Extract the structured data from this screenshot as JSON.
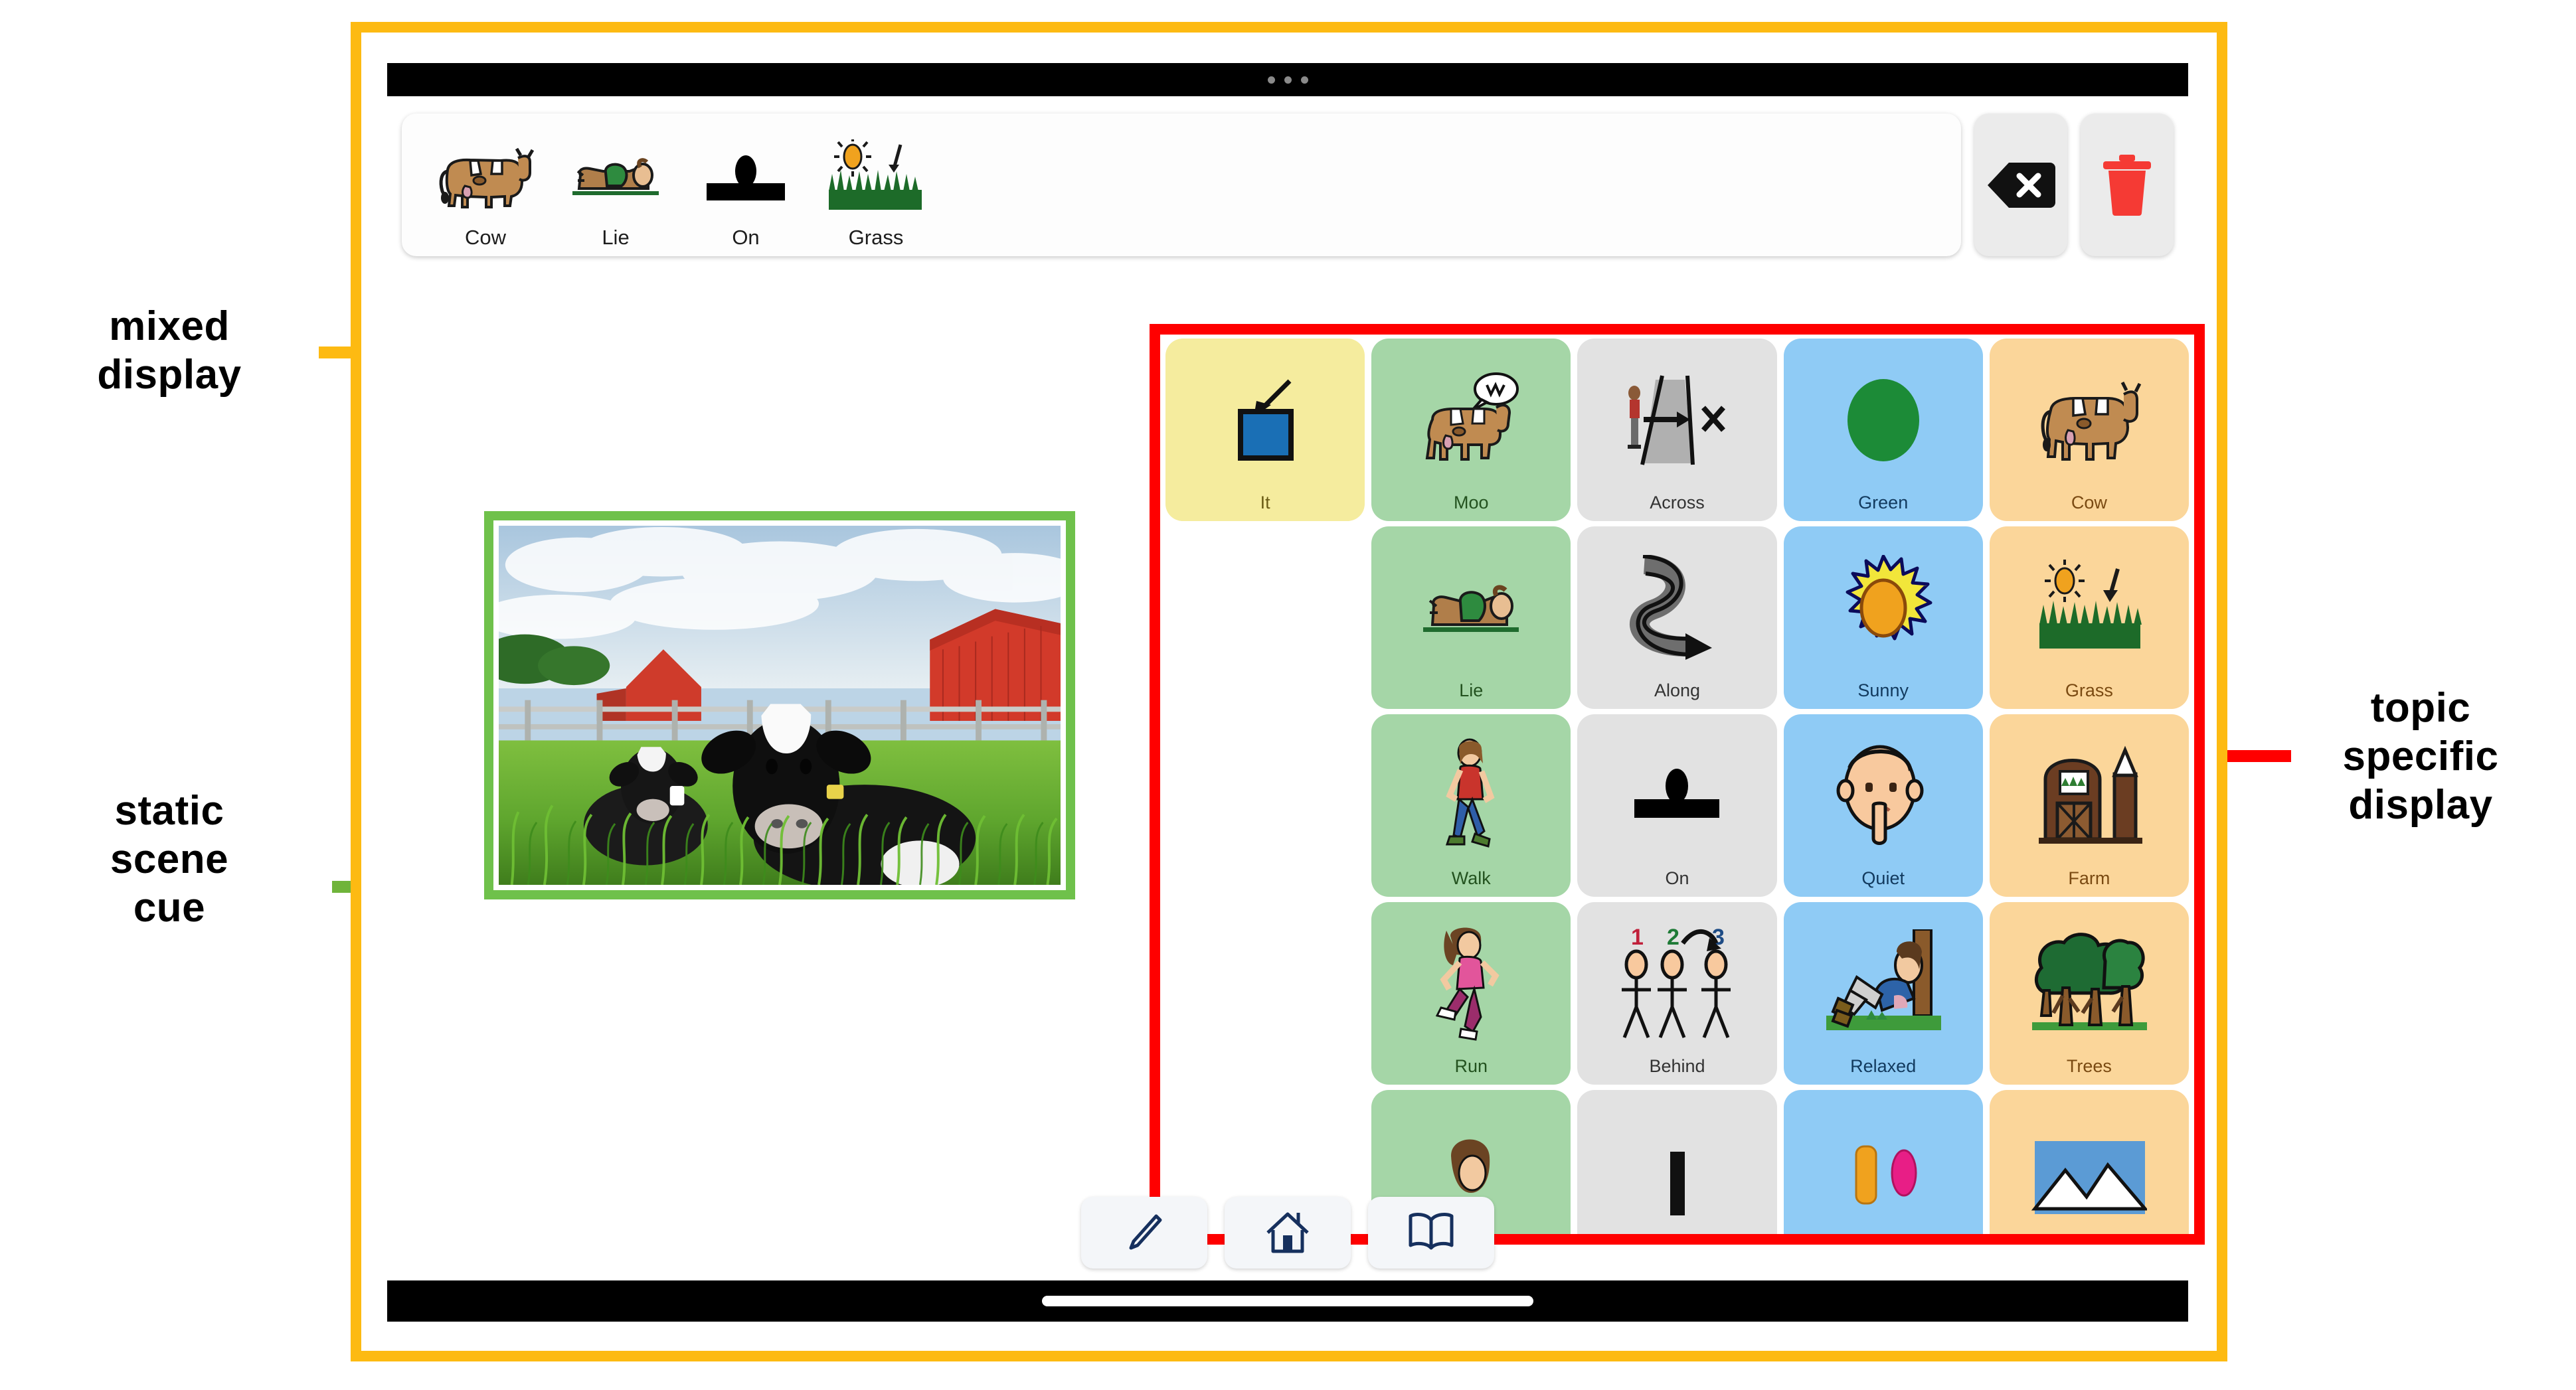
{
  "annotations": {
    "mixed_display": {
      "label": "mixed\ndisplay",
      "line1": "mixed",
      "line2": "display",
      "color": "#FDBA12"
    },
    "static_scene_cue": {
      "line1": "static",
      "line2": "scene",
      "line3": "cue",
      "color": "#6FC14B"
    },
    "topic_specific_display": {
      "line1": "topic",
      "line2": "specific",
      "line3": "display",
      "color": "#FF0000"
    }
  },
  "device": {
    "status_bar": {
      "dots": 3
    },
    "home_indicator": true
  },
  "sentence_bar": {
    "words": [
      {
        "label": "Cow",
        "icon": "cow-symbol"
      },
      {
        "label": "Lie",
        "icon": "lie-symbol"
      },
      {
        "label": "On",
        "icon": "on-symbol"
      },
      {
        "label": "Grass",
        "icon": "grass-symbol"
      }
    ],
    "actions": [
      {
        "name": "backspace-button",
        "icon": "backspace-icon",
        "color": "#111111"
      },
      {
        "name": "clear-button",
        "icon": "trash-icon",
        "color": "#F53A34"
      }
    ]
  },
  "scene_cue": {
    "caption": "",
    "description": "two black and white cows lying in tall green grass with red barns and a wooden fence",
    "border_color": "#6FC14B"
  },
  "topic_display": {
    "border_color": "#FF0000",
    "colors": {
      "pronoun": "#F5EC9E",
      "verb": "#A5D6A7",
      "preposition": "#E2E2E2",
      "adjective": "#8FCBF5",
      "noun": "#FBD69A"
    },
    "rows": [
      [
        {
          "label": "It",
          "type": "pronoun",
          "icon": "blue-square-arrow-symbol"
        },
        {
          "label": "Moo",
          "type": "verb",
          "icon": "cow-speaking-symbol"
        },
        {
          "label": "Across",
          "type": "preposition",
          "icon": "across-symbol"
        },
        {
          "label": "Green",
          "type": "adjective",
          "icon": "green-circle-symbol"
        },
        {
          "label": "Cow",
          "type": "noun",
          "icon": "cow-symbol"
        }
      ],
      [
        {
          "label": "",
          "type": "empty",
          "icon": ""
        },
        {
          "label": "Lie",
          "type": "verb",
          "icon": "lie-symbol"
        },
        {
          "label": "Along",
          "type": "preposition",
          "icon": "winding-road-symbol"
        },
        {
          "label": "Sunny",
          "type": "adjective",
          "icon": "sun-symbol"
        },
        {
          "label": "Grass",
          "type": "noun",
          "icon": "grass-symbol"
        }
      ],
      [
        {
          "label": "",
          "type": "empty",
          "icon": ""
        },
        {
          "label": "Walk",
          "type": "verb",
          "icon": "walking-person-symbol"
        },
        {
          "label": "On",
          "type": "preposition",
          "icon": "on-symbol"
        },
        {
          "label": "Quiet",
          "type": "adjective",
          "icon": "shush-face-symbol"
        },
        {
          "label": "Farm",
          "type": "noun",
          "icon": "barn-silo-symbol"
        }
      ],
      [
        {
          "label": "",
          "type": "empty",
          "icon": ""
        },
        {
          "label": "Run",
          "type": "verb",
          "icon": "running-person-symbol"
        },
        {
          "label": "Behind",
          "type": "preposition",
          "icon": "three-figures-arrow-symbol"
        },
        {
          "label": "Relaxed",
          "type": "adjective",
          "icon": "person-resting-tree-symbol"
        },
        {
          "label": "Trees",
          "type": "noun",
          "icon": "trees-symbol"
        }
      ],
      [
        {
          "label": "",
          "type": "empty",
          "icon": ""
        },
        {
          "label": "",
          "type": "verb",
          "icon": "person-head-symbol"
        },
        {
          "label": "",
          "type": "preposition",
          "icon": "black-block-symbol"
        },
        {
          "label": "",
          "type": "adjective",
          "icon": "two-bottles-symbol"
        },
        {
          "label": "",
          "type": "noun",
          "icon": "mountain-sky-symbol"
        }
      ]
    ]
  },
  "toolbar": {
    "buttons": [
      {
        "name": "edit-button",
        "icon": "pencil-icon"
      },
      {
        "name": "home-button",
        "icon": "home-icon"
      },
      {
        "name": "book-button",
        "icon": "book-icon"
      }
    ]
  }
}
